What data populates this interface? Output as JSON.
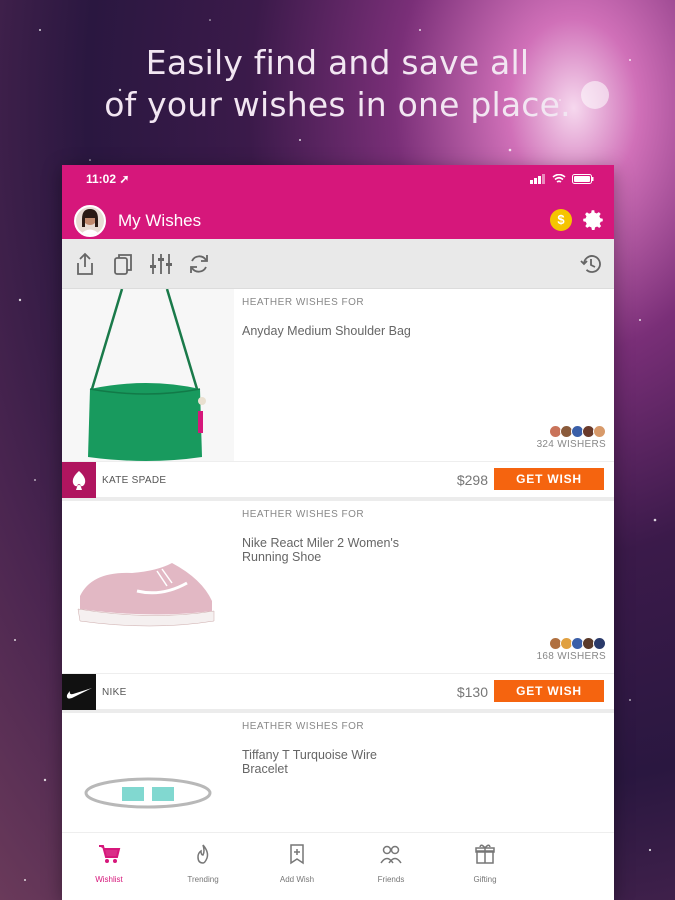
{
  "headline": {
    "line1": "Easily find and save all",
    "line2": "of your wishes in one place."
  },
  "status": {
    "time": "11:02"
  },
  "header": {
    "title": "My Wishes",
    "coin_symbol": "$",
    "accent_color": "#d6177b"
  },
  "toolbar": {
    "icons": [
      "share-icon",
      "copy-icon",
      "filter-icon",
      "refresh-icon",
      "history-icon"
    ]
  },
  "wishes": [
    {
      "who": "HEATHER WISHES FOR",
      "name": "Anyday Medium Shoulder Bag",
      "wishers": "324 WISHERS",
      "brand": "KATE SPADE",
      "price": "$298",
      "cta": "GET WISH"
    },
    {
      "who": "HEATHER WISHES FOR",
      "name": "Nike React Miler 2 Women's Running Shoe",
      "wishers": "168 WISHERS",
      "brand": "NIKE",
      "price": "$130",
      "cta": "GET WISH"
    },
    {
      "who": "HEATHER WISHES FOR",
      "name": "Tiffany T Turquoise Wire Bracelet"
    }
  ],
  "tabs": [
    {
      "label": "Wishlist",
      "icon": "cart-icon",
      "active": true
    },
    {
      "label": "Trending",
      "icon": "flame-icon",
      "active": false
    },
    {
      "label": "Add Wish",
      "icon": "bookmark-add-icon",
      "active": false
    },
    {
      "label": "Friends",
      "icon": "people-icon",
      "active": false
    },
    {
      "label": "Gifting",
      "icon": "gift-icon",
      "active": false
    }
  ]
}
